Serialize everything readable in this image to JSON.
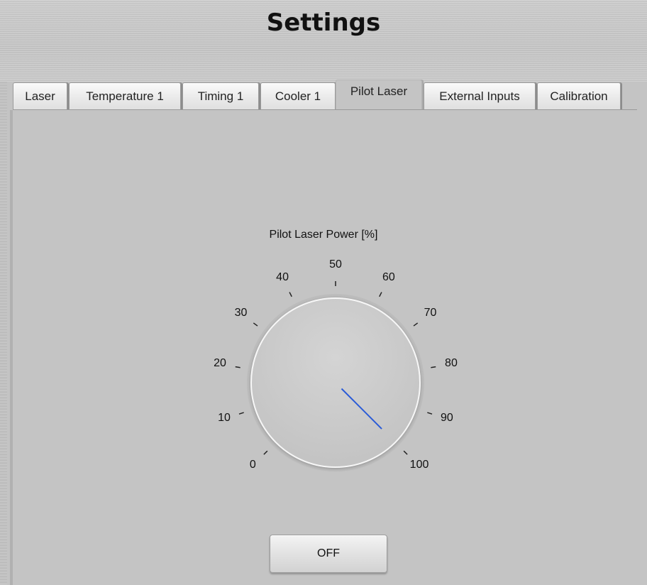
{
  "window": {
    "title": "Settings"
  },
  "tabs": [
    {
      "label": "Laser"
    },
    {
      "label": "Temperature 1"
    },
    {
      "label": "Timing 1"
    },
    {
      "label": "Cooler 1"
    },
    {
      "label": "Pilot Laser"
    },
    {
      "label": "External Inputs"
    },
    {
      "label": "Calibration"
    }
  ],
  "active_tab": "Pilot Laser",
  "pilot_laser": {
    "knob_label": "Pilot Laser Power [%]",
    "scale": {
      "min": 0,
      "max": 100,
      "labels": [
        "0",
        "10",
        "20",
        "30",
        "40",
        "50",
        "60",
        "70",
        "80",
        "90",
        "100"
      ]
    },
    "value_percent": 100,
    "needle_color": "#2a5bd7",
    "off_button_label": "OFF"
  }
}
